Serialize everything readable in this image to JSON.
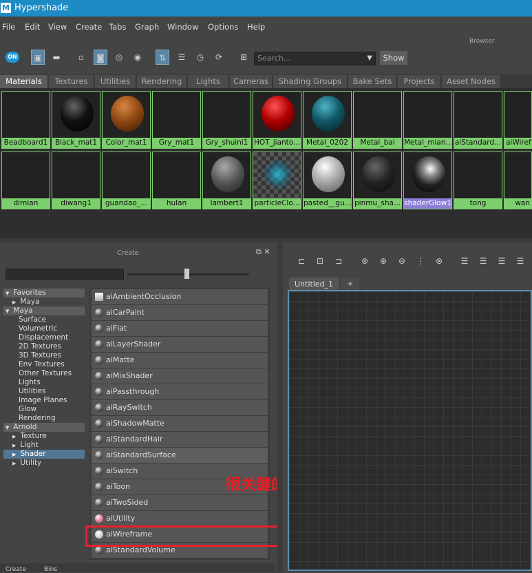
{
  "window": {
    "title": "Hypershade",
    "logo": "M"
  },
  "menu": [
    "File",
    "Edit",
    "View",
    "Create",
    "Tabs",
    "Graph",
    "Window",
    "Options",
    "Help"
  ],
  "browser_label": "Browser",
  "toolbar": {
    "on_label": "ON",
    "search_placeholder": "Search...",
    "show_label": "Show",
    "dropdown_glyph": "▼"
  },
  "tabs": [
    "Materials",
    "Textures",
    "Utilities",
    "Rendering",
    "Lights",
    "Cameras",
    "Shading Groups",
    "Bake Sets",
    "Projects",
    "Asset Nodes"
  ],
  "materials_row1": [
    "Beadboard1",
    "Black_mat1",
    "Color_mat1",
    "Gry_mat1",
    "Gry_shuini1",
    "HOT_jianto...",
    "Metal_0202",
    "Metal_bai",
    "Metal_mian...",
    "aiStandard...",
    "aiWirefra"
  ],
  "materials_row2": [
    "dimian",
    "diwang1",
    "guandao_...",
    "hulan",
    "lambert1",
    "particleClo...",
    "pasted__gu...",
    "pinmu_sha...",
    "shaderGlow1",
    "tong",
    "wan"
  ],
  "create_panel": {
    "title": "Create",
    "bottom_tabs": [
      "Create",
      "Bins"
    ]
  },
  "tree": [
    {
      "label": "Favorites",
      "type": "hdr",
      "arrow": "▼"
    },
    {
      "label": "Maya",
      "type": "child",
      "arrow": "▶"
    },
    {
      "label": "Maya",
      "type": "hdr",
      "arrow": "▼"
    },
    {
      "label": "Surface",
      "type": "leaf"
    },
    {
      "label": "Volumetric",
      "type": "leaf"
    },
    {
      "label": "Displacement",
      "type": "leaf"
    },
    {
      "label": "2D Textures",
      "type": "leaf"
    },
    {
      "label": "3D Textures",
      "type": "leaf"
    },
    {
      "label": "Env Textures",
      "type": "leaf"
    },
    {
      "label": "Other Textures",
      "type": "leaf"
    },
    {
      "label": "Lights",
      "type": "leaf"
    },
    {
      "label": "Utilities",
      "type": "leaf"
    },
    {
      "label": "Image Planes",
      "type": "leaf"
    },
    {
      "label": "Glow",
      "type": "leaf"
    },
    {
      "label": "Rendering",
      "type": "leaf"
    },
    {
      "label": "Arnold",
      "type": "hdr",
      "arrow": "▼"
    },
    {
      "label": "Texture",
      "type": "child",
      "arrow": "▶"
    },
    {
      "label": "Light",
      "type": "child",
      "arrow": "▶"
    },
    {
      "label": "Shader",
      "type": "sel",
      "arrow": "▶"
    },
    {
      "label": "Utility",
      "type": "child",
      "arrow": "▶"
    }
  ],
  "shaders": [
    "aiAmbientOcclusion",
    "aiCarPaint",
    "aiFlat",
    "aiLayerShader",
    "aiMatte",
    "aiMixShader",
    "aiPassthrough",
    "aiRaySwitch",
    "aiShadowMatte",
    "aiStandardHair",
    "aiStandardSurface",
    "aiSwitch",
    "aiToon",
    "aiTwoSided",
    "aiUtility",
    "aiWireframe",
    "aiStandardVolume"
  ],
  "annotation": "很关键的一个节点",
  "graph": {
    "tab_label": "Untitled_1",
    "plus_label": "+"
  },
  "colors": {
    "title_bar": "#1d8bc4",
    "swatch_label": "#7dcf6d",
    "selected_swatch": "#8a7fd4",
    "highlight_box": "#e8202a"
  }
}
